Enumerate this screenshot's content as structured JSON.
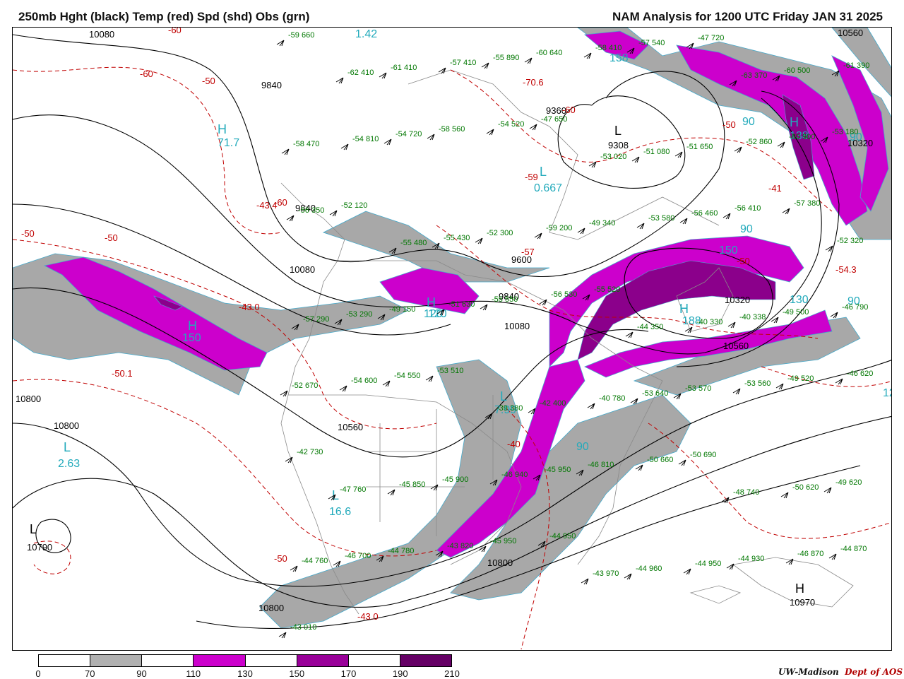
{
  "header": {
    "left": "250mb Hght (black) Temp (red) Spd (shd) Obs (grn)",
    "right": "NAM Analysis for 1200 UTC Friday  JAN 31 2025"
  },
  "legend": {
    "ticks": [
      "0",
      "70",
      "90",
      "110",
      "130",
      "150",
      "170",
      "190",
      "210"
    ],
    "colors": [
      "#ffffff",
      "#b0b0b0",
      "#ffffff",
      "#cc00cc",
      "#ffffff",
      "#990099",
      "#ffffff",
      "#660066"
    ]
  },
  "credit": {
    "name": "UW-Madison",
    "dept": "Dept of AOS"
  },
  "colors": {
    "height": "#000000",
    "temp": "#c00000",
    "obs": "#007700",
    "speed_label": "#22aabb",
    "gray": "#a8a8a8",
    "magenta": "#cc00cc",
    "purple": "#8b008b"
  },
  "height_labels": [
    "10080",
    "9840",
    "9840",
    "10080",
    "10800",
    "10800",
    "10560",
    "9600",
    "9840",
    "10080",
    "9360",
    "9308",
    "10320",
    "10560",
    "10320",
    "10560",
    "10800",
    "10800",
    "10970",
    "10790"
  ],
  "temp_labels": [
    "-60",
    "-60",
    "-50",
    "-60",
    "-70.6",
    "-60",
    "-50",
    "-41",
    "-50",
    "-50",
    "-43.4",
    "-43.0",
    "-50.1",
    "-50",
    "-54.3",
    "-50",
    "-40",
    "-43.0",
    "-59",
    "-57"
  ],
  "speed_labels": [
    "1.42",
    "71.7",
    "158",
    "150",
    "120",
    "150",
    "90",
    "90",
    "130",
    "90",
    "188",
    "120",
    "90",
    "7.99",
    "90",
    "2.63",
    "16.6",
    "0.667",
    "138",
    "12"
  ],
  "centers": [
    {
      "type": "H",
      "value": "71.7"
    },
    {
      "type": "L",
      "value": "2.63"
    },
    {
      "type": "L",
      "value": "16.6"
    },
    {
      "type": "H",
      "value": "158"
    },
    {
      "type": "H",
      "value": "120"
    },
    {
      "type": "H",
      "value": "188"
    },
    {
      "type": "L",
      "value": "0.667"
    },
    {
      "type": "L",
      "value": "7.99"
    },
    {
      "type": "H",
      "value": "138"
    },
    {
      "type": "L",
      "value": "9308"
    },
    {
      "type": "H",
      "value": "10970"
    },
    {
      "type": "L",
      "value": "10790"
    }
  ],
  "observations": [
    "-59 660",
    "-62 410",
    "-61 410",
    "-57 410",
    "-55 890",
    "-60 640",
    "-58 410",
    "-57 540",
    "-47 720",
    "-63 370",
    "-60 500",
    "-61 390",
    "-58 470",
    "-54 810",
    "-54 720",
    "-58 560",
    "-54 520",
    "-47 650",
    "-53 020",
    "-51 080",
    "-51 650",
    "-52 860",
    "-60 900",
    "-53 180",
    "-56 350",
    "-52 120",
    "-55 480",
    "-55 430",
    "-52 300",
    "-59 200",
    "-49 340",
    "-53 580",
    "-56 460",
    "-56 410",
    "-57 380",
    "-52 320",
    "-57 290",
    "-53 290",
    "-49 150",
    "-51 630",
    "-55 550",
    "-56 530",
    "-55 520",
    "-44 350",
    "-40 330",
    "-40 338",
    "-49 500",
    "-46 790",
    "-52 670",
    "-54 600",
    "-54 550",
    "-53 510",
    "-39 380",
    "-42 400",
    "-40 780",
    "-53 640",
    "-53 570",
    "-53 560",
    "-49 520",
    "-46 620",
    "-42 730",
    "-47 760",
    "-45 850",
    "-45 900",
    "-46 940",
    "-45 950",
    "-46 810",
    "-50 660",
    "-50 690",
    "-48 740",
    "-50 620",
    "-49 620",
    "-44 760",
    "-46 700",
    "-44 780",
    "-43 820",
    "-45 950",
    "-44 950",
    "-43 970",
    "-44 960",
    "-44 950",
    "-44 930",
    "-46 870",
    "-44 870",
    "-43 010"
  ]
}
